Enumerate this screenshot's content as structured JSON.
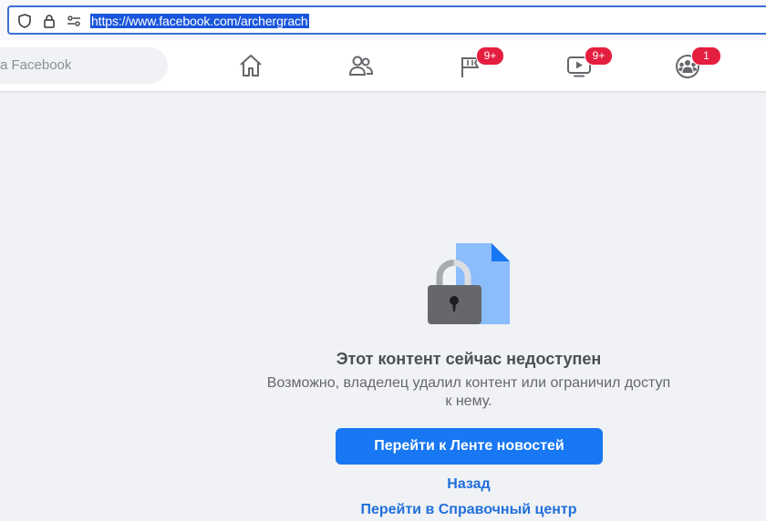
{
  "browser": {
    "url": "https://www.facebook.com/archergrach",
    "icons": [
      "shield-icon",
      "lock-icon",
      "permissions-icon"
    ]
  },
  "nav": {
    "search_placeholder": "а Facebook",
    "items": [
      {
        "name": "home",
        "icon": "home-icon",
        "badge": ""
      },
      {
        "name": "friends",
        "icon": "friends-icon",
        "badge": ""
      },
      {
        "name": "pages",
        "icon": "flag-icon",
        "badge": "9+"
      },
      {
        "name": "watch",
        "icon": "video-icon",
        "badge": "9+"
      },
      {
        "name": "groups",
        "icon": "groups-icon",
        "badge": "1"
      }
    ]
  },
  "content": {
    "title": "Этот контент сейчас недоступен",
    "description": "Возможно, владелец удалил контент или ограничил доступ к нему.",
    "primary_button": "Перейти к Ленте новостей",
    "back_link": "Назад",
    "help_link": "Перейти в Справочный центр"
  },
  "colors": {
    "accent": "#1877f2",
    "badge": "#e41e3f",
    "page_bg": "#f0f2f5",
    "url_highlight": "#1a56db"
  }
}
